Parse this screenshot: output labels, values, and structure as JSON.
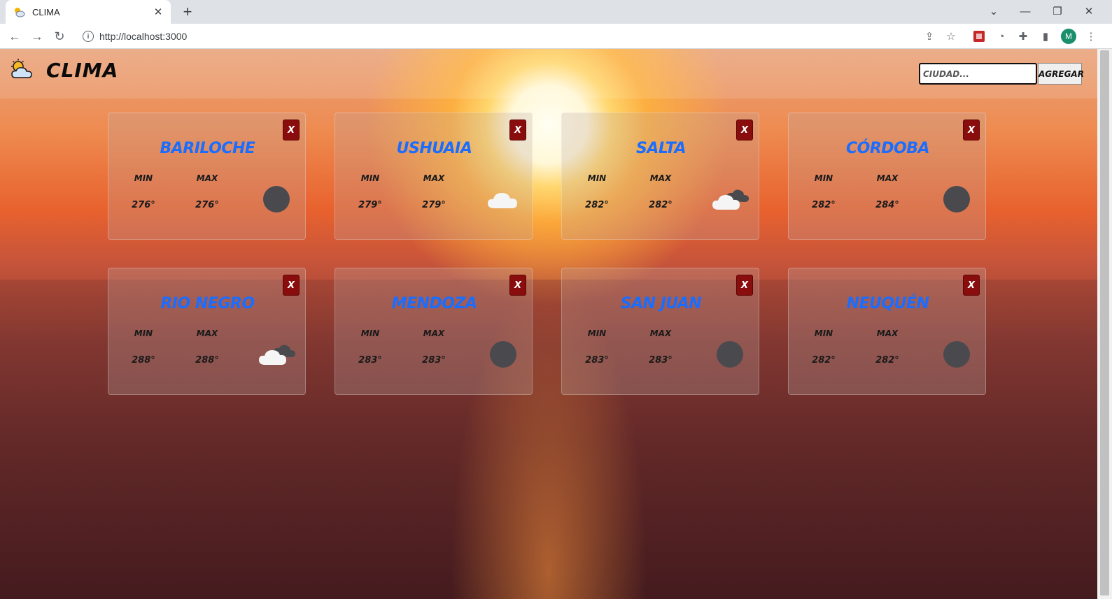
{
  "browser": {
    "tab_title": "CLIMA",
    "url": "http://localhost:3000",
    "profile_initial": "M"
  },
  "app": {
    "brand": "CLIMA",
    "search_placeholder": "CIUDAD...",
    "add_label": "AGREGAR",
    "close_label": "X",
    "min_label": "MIN",
    "max_label": "MAX"
  },
  "cards": [
    {
      "city": "BARILOCHE",
      "min": "276°",
      "max": "276°",
      "icon": "moon-icon"
    },
    {
      "city": "USHUAIA",
      "min": "279°",
      "max": "279°",
      "icon": "cloud-icon"
    },
    {
      "city": "SALTA",
      "min": "282°",
      "max": "282°",
      "icon": "clouds-icon"
    },
    {
      "city": "CÓRDOBA",
      "min": "282°",
      "max": "284°",
      "icon": "moon-icon"
    },
    {
      "city": "RIO NEGRO",
      "min": "288°",
      "max": "288°",
      "icon": "clouds-icon"
    },
    {
      "city": "MENDOZA",
      "min": "283°",
      "max": "283°",
      "icon": "moon-icon"
    },
    {
      "city": "SAN JUAN",
      "min": "283°",
      "max": "283°",
      "icon": "moon-icon"
    },
    {
      "city": "NEUQUÉN",
      "min": "282°",
      "max": "282°",
      "icon": "moon-icon"
    }
  ],
  "colors": {
    "city": "#1a6dff",
    "close_button": "#8a0d0d"
  }
}
